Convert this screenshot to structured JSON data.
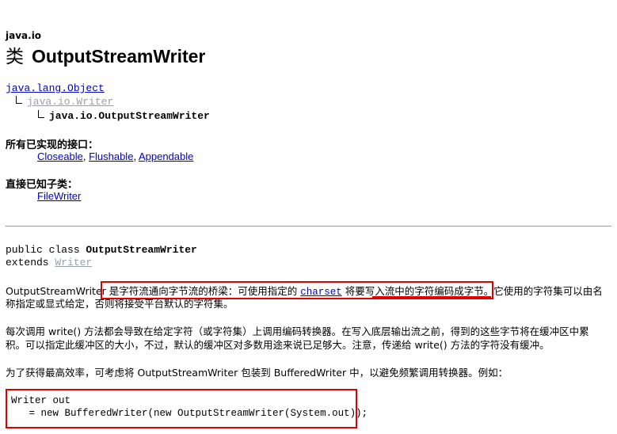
{
  "header": {
    "package": "java.io",
    "kind": "类",
    "class_name": "OutputStreamWriter"
  },
  "hierarchy": {
    "root": "java.lang.Object",
    "parent": "java.io.Writer",
    "current": "java.io.OutputStreamWriter"
  },
  "interfaces": {
    "heading": "所有已实现的接口：",
    "items": [
      "Closeable",
      "Flushable",
      "Appendable"
    ]
  },
  "subclasses": {
    "heading": "直接已知子类：",
    "items": [
      "FileWriter"
    ]
  },
  "declaration": {
    "prefix": "public class ",
    "name": "OutputStreamWriter",
    "extends_kw": "extends ",
    "extends_name": "Writer"
  },
  "description": {
    "p1_lead": "OutputStreamWriter ",
    "p1_highlight_a": "是字符流通向字节流的桥梁：可使用指定的 ",
    "p1_charset": "charset",
    "p1_highlight_b": " 将要写入流中的字符编码成字节",
    "p1_rest_line1": "。它使用的字符集可以由名",
    "p1_line2": "称指定或显式给定，否则将接受平台默认的字符集。",
    "p2_line1": "每次调用  write() 方法都会导致在给定字符（或字符集）上调用编码转换器。在写入底层输出流之前，得到的这些字节将在缓冲区中累",
    "p2_line2": "积。可以指定此缓冲区的大小，不过，默认的缓冲区对多数用途来说已足够大。注意，传递给  write() 方法的字符没有缓冲。",
    "p3": "为了获得最高效率，可考虑将  OutputStreamWriter 包装到  BufferedWriter 中，以避免频繁调用转换器。例如："
  },
  "code": {
    "line1": "Writer out",
    "line2": "   = new BufferedWriter(new OutputStreamWriter(System.out));"
  },
  "colors": {
    "link": "#0000cc",
    "inherited_link": "#9aa0a8",
    "highlight_box": "#e00000"
  }
}
